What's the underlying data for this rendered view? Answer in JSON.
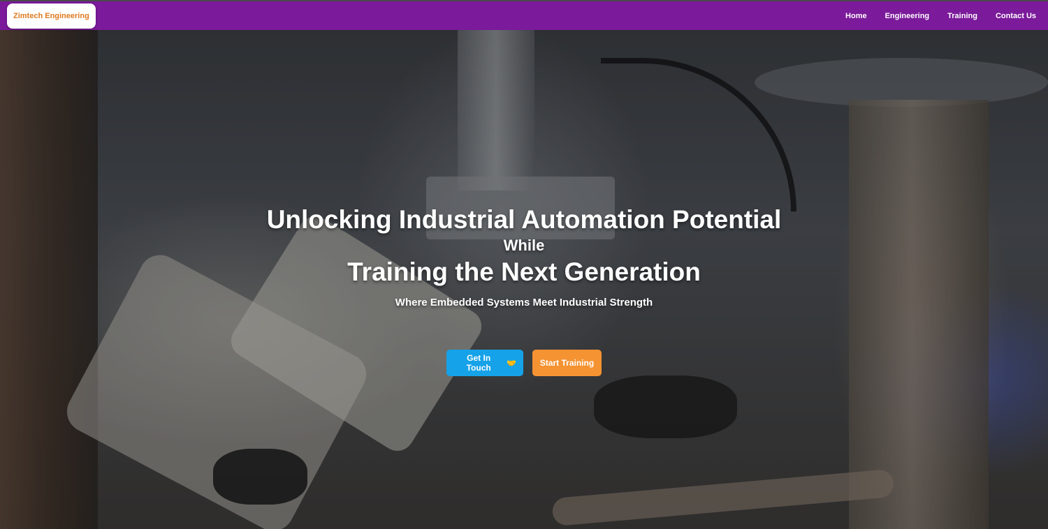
{
  "navbar": {
    "brand": "Zimtech Engineering",
    "links": [
      "Home",
      "Engineering",
      "Training",
      "Contact Us"
    ]
  },
  "hero": {
    "line1": "Unlocking Industrial Automation Potential",
    "line2": "While",
    "line3": "Training the Next Generation",
    "tagline": "Where Embedded Systems Meet Industrial Strength",
    "buttons": {
      "touch_label": "Get In Touch",
      "touch_icon": "handshake-icon",
      "train_label": "Start Training"
    }
  },
  "colors": {
    "navbar": "#7b1a9a",
    "brand_text": "#e07a1f",
    "touch_button": "#16a2e8",
    "train_button": "#f59332"
  }
}
